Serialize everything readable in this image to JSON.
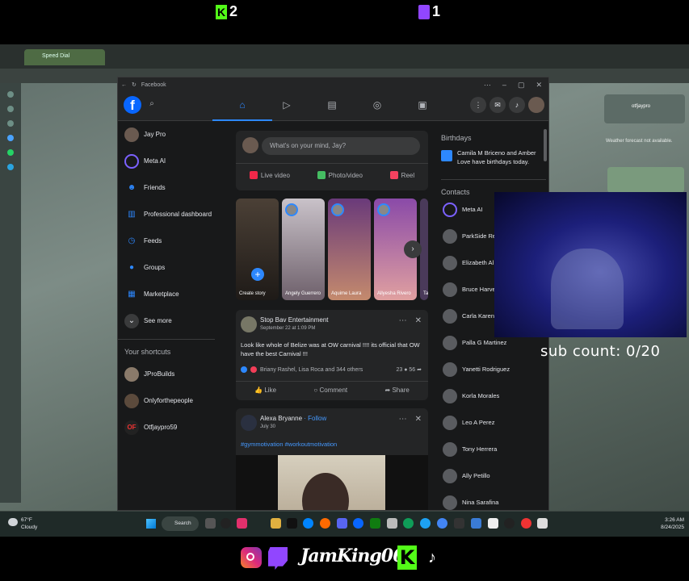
{
  "overlay": {
    "kick_count": "2",
    "twitch_count": "1",
    "sub_count_label": "sub count:",
    "sub_count_value": "0/20",
    "handle": "JamKing060"
  },
  "background_browser": {
    "tab_label": "Speed Dial",
    "profile_name": "otfjaypro",
    "weather_text": "Weather forecast not available."
  },
  "window": {
    "title": "Facebook"
  },
  "left_nav": {
    "items": [
      {
        "label": "Jay Pro",
        "icon": "avatar"
      },
      {
        "label": "Meta AI",
        "icon": "meta-ai-icon"
      },
      {
        "label": "Friends",
        "icon": "friends-icon"
      },
      {
        "label": "Professional dashboard",
        "icon": "dashboard-icon"
      },
      {
        "label": "Feeds",
        "icon": "feeds-icon"
      },
      {
        "label": "Groups",
        "icon": "groups-icon"
      },
      {
        "label": "Marketplace",
        "icon": "marketplace-icon"
      },
      {
        "label": "See more",
        "icon": "chevron-down-icon"
      }
    ],
    "shortcuts_title": "Your shortcuts",
    "shortcuts": [
      {
        "label": "JProBuilds"
      },
      {
        "label": "Onlyforthepeople"
      },
      {
        "label": "Otfjaypro59"
      }
    ]
  },
  "composer": {
    "placeholder": "What's on your mind, Jay?",
    "live_video": "Live video",
    "photo_video": "Photo/video",
    "reel": "Reel"
  },
  "stories": [
    {
      "label": "Create story"
    },
    {
      "label": "Angely Guerrero"
    },
    {
      "label": "Aquime Laura"
    },
    {
      "label": "Allyesha Rivero"
    },
    {
      "label": "Ta"
    }
  ],
  "posts": [
    {
      "author": "Stop Bav Entertainment",
      "date": "September 22 at 1:09 PM",
      "text": "Look like whole of Belize was at OW carnival !!!! its official that OW have the best Carnival !!!",
      "reactions": "Briany Rashel, Lisa Roca and 344 others",
      "comments": "23",
      "shares": "56",
      "like": "Like",
      "comment": "Comment",
      "share": "Share"
    },
    {
      "author": "Alexa Bryanne",
      "follow": "· Follow",
      "date": "July 30",
      "tags": "#gymmotivation #workoutmotivation"
    }
  ],
  "right_col": {
    "birthdays_title": "Birthdays",
    "birthday_text": "Camila M Briceno and Amber Love have birthdays today.",
    "contacts_title": "Contacts",
    "contacts": [
      "Meta AI",
      "ParkSide Rel",
      "Elizabeth Al",
      "Bruce Harve",
      "Carla Karen",
      "Palla G Martinez",
      "Yanetti Rodriguez",
      "Korla Morales",
      "Leo A Perez",
      "Tony Herrera",
      "Ally Petillo",
      "Nina Sarafina"
    ]
  },
  "taskbar": {
    "temperature": "67°F",
    "condition": "Cloudy",
    "search_label": "Search",
    "time": "3:26 AM",
    "date": "8/24/2025"
  },
  "colors": {
    "fb_blue": "#0866ff",
    "kick_green": "#53fc18",
    "twitch_purple": "#9146ff"
  }
}
